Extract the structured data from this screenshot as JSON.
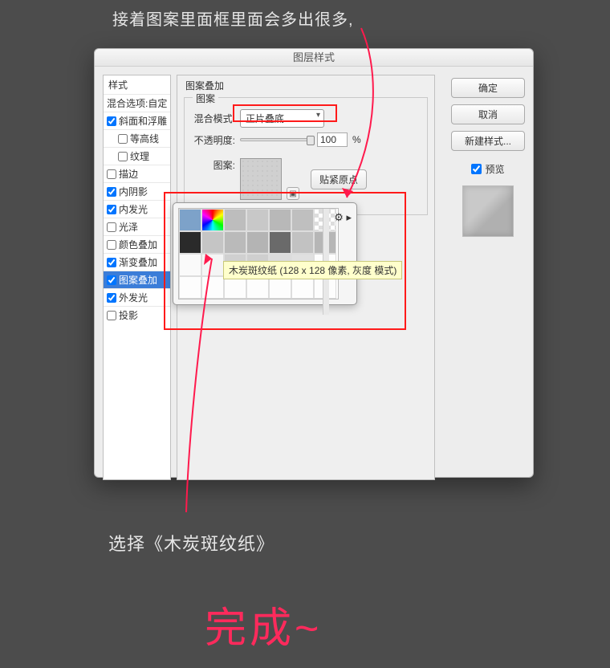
{
  "annotations": {
    "top": "接着图案里面框里面会多出很多,",
    "bottom": "选择《木炭斑纹纸》",
    "done": "完成~"
  },
  "dialog": {
    "title": "图层样式"
  },
  "sidebar": {
    "heading": "样式",
    "blend_opts": "混合选项:自定",
    "items": [
      {
        "label": "斜面和浮雕",
        "checked": true
      },
      {
        "label": "等高线",
        "checked": false
      },
      {
        "label": "纹理",
        "checked": false
      },
      {
        "label": "描边",
        "checked": false
      },
      {
        "label": "内阴影",
        "checked": true
      },
      {
        "label": "内发光",
        "checked": true
      },
      {
        "label": "光泽",
        "checked": false
      },
      {
        "label": "颜色叠加",
        "checked": false
      },
      {
        "label": "渐变叠加",
        "checked": true
      },
      {
        "label": "图案叠加",
        "checked": true
      },
      {
        "label": "外发光",
        "checked": true
      },
      {
        "label": "投影",
        "checked": false
      }
    ]
  },
  "main": {
    "section_title": "图案叠加",
    "fieldset_title": "图案",
    "blend_mode_label": "混合模式:",
    "blend_mode_value": "正片叠底",
    "opacity_label": "不透明度:",
    "opacity_value": "100",
    "opacity_unit": "%",
    "pattern_label": "图案:",
    "snap_button": "贴紧原点"
  },
  "right": {
    "ok": "确定",
    "cancel": "取消",
    "new_style": "新建样式...",
    "preview_label": "预览"
  },
  "tooltip": {
    "text": "木炭斑纹纸 (128 x 128 像素, 灰度 模式)"
  },
  "pattern_picker": {
    "gear_icon": "gear",
    "swatch_colors": [
      "#7da2c9",
      "#e68a00",
      "#bdbdbd",
      "#c8c8c8",
      "#b8b8b8",
      "#bfbfbf",
      "#f0f0f0",
      "#2a2a2a",
      "#c5c5c5",
      "#bababa",
      "#b4b4b4",
      "#6a6a6a",
      "#c2c2c2",
      "#b6b6b6",
      "#fafafa",
      "#f5f5f5",
      "#d0d0d0",
      "#cfcfcf",
      "#dcdcdc",
      "#e0e0e0",
      "#fdfdfd",
      "#fdfdfd",
      "#fdfdfd",
      "#fdfdfd",
      "#fdfdfd",
      "#fdfdfd",
      "#fdfdfd",
      "#fdfdfd"
    ]
  }
}
